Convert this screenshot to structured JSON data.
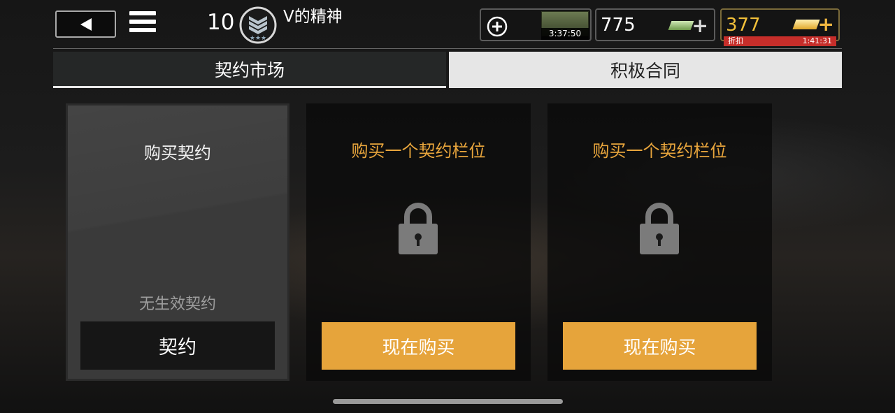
{
  "header": {
    "level": "10",
    "player_name": "V的精神",
    "resources": {
      "crate_timer": "3:37:50",
      "cash": "775",
      "gold": "377",
      "discount_label": "折扣",
      "discount_timer": "1:41:31"
    }
  },
  "tabs": [
    {
      "label": "契约市场",
      "active": false
    },
    {
      "label": "积极合同",
      "active": true
    }
  ],
  "cards": [
    {
      "title": "购买契约",
      "status": "无生效契约",
      "button": "契约"
    },
    {
      "title": "购买一个契约栏位",
      "button": "现在购买",
      "locked": true
    },
    {
      "title": "购买一个契约栏位",
      "button": "现在购买",
      "locked": true
    }
  ],
  "colors": {
    "accent_orange": "#e6a43b",
    "title_orange": "#e8a53c",
    "gold": "#f2c03a",
    "discount_red": "#c62e2a"
  },
  "icons": [
    "back-arrow-icon",
    "menu-icon",
    "rank-badge-icon",
    "plus-circle-icon",
    "crate-icon",
    "cash-icon",
    "gold-icon",
    "plus-icon",
    "lock-icon"
  ]
}
